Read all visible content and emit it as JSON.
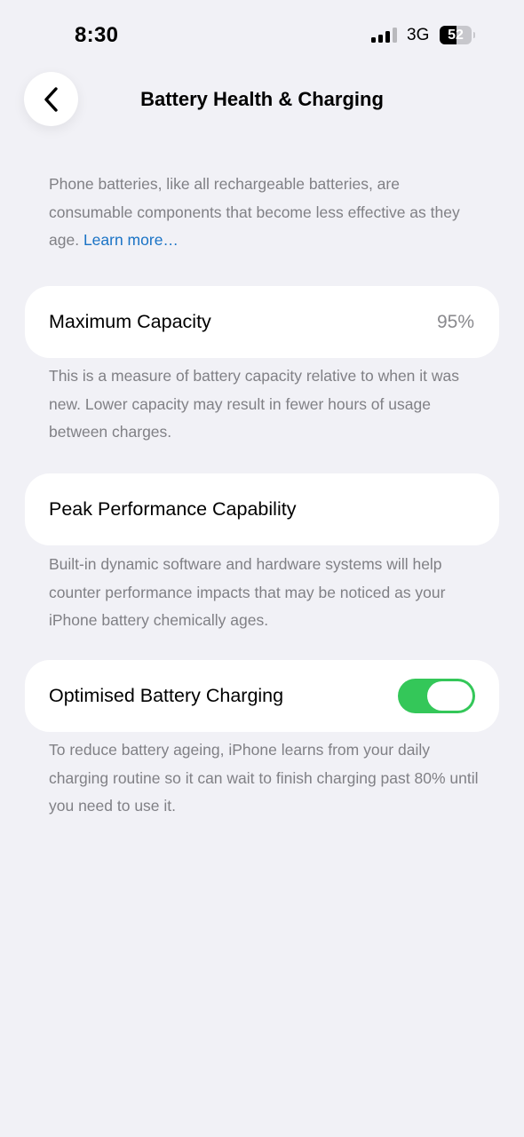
{
  "status_bar": {
    "time": "8:30",
    "network": "3G",
    "battery_level": "52",
    "battery_fraction": 0.52,
    "signal_bars_active": 3,
    "signal_bars_total": 4
  },
  "header": {
    "title": "Battery Health & Charging",
    "back_icon": "chevron-left-icon"
  },
  "intro": {
    "text": "Phone batteries, like all rechargeable batteries, are consumable components that become less effective as they age. ",
    "link_text": "Learn more…"
  },
  "maximum_capacity": {
    "label": "Maximum Capacity",
    "value": "95%",
    "description": "This is a measure of battery capacity relative to when it was new. Lower capacity may result in fewer hours of usage between charges."
  },
  "peak_performance": {
    "label": "Peak Performance Capability",
    "description": "Built-in dynamic software and hardware systems will help counter performance impacts that may be noticed as your iPhone battery chemically ages."
  },
  "optimised_charging": {
    "label": "Optimised Battery Charging",
    "enabled": true,
    "description": "To reduce battery ageing, iPhone learns from your daily charging routine so it can wait to finish charging past 80% until you need to use it."
  },
  "colors": {
    "background": "#f1f1f6",
    "toggle_on": "#34c759",
    "link": "#1a73c5",
    "secondary_text": "#808085"
  }
}
